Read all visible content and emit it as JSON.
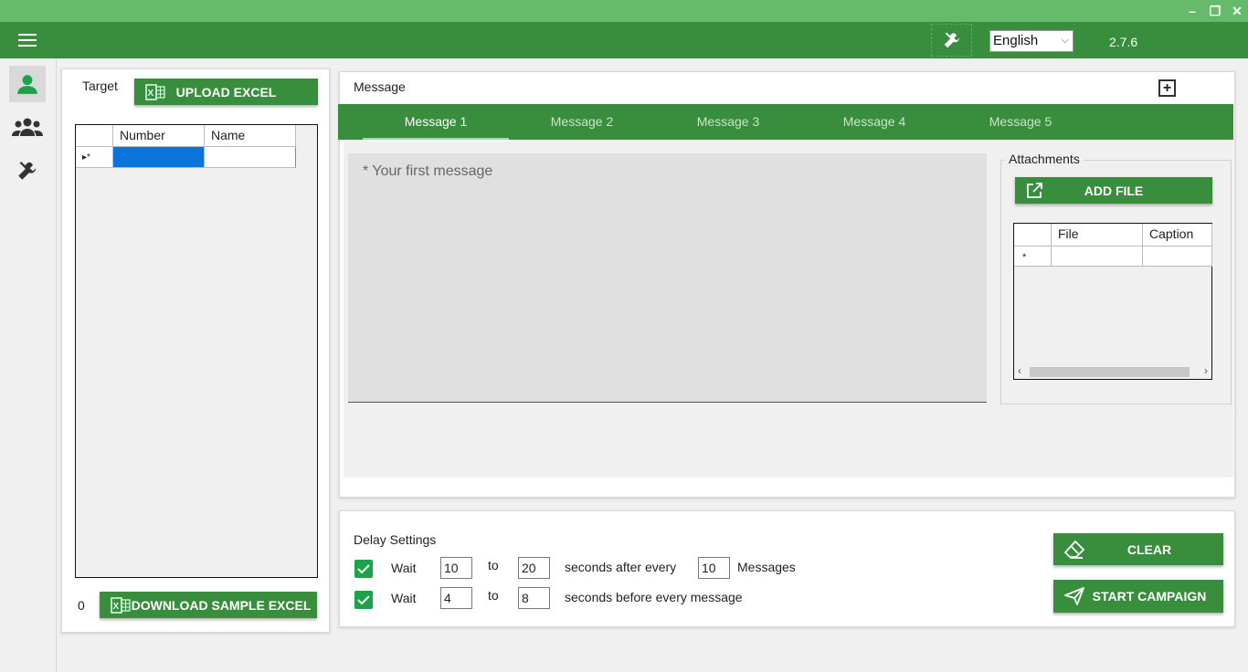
{
  "window": {
    "minimize": "–",
    "maximize": "❐",
    "close": "✕"
  },
  "toolbar": {
    "language": "English",
    "version": "2.7.6"
  },
  "target": {
    "label": "Target",
    "upload_label": "UPLOAD EXCEL",
    "columns": [
      "Number",
      "Name"
    ],
    "row_marker": "▸*",
    "count": "0",
    "download_label": "DOWNLOAD SAMPLE EXCEL"
  },
  "message": {
    "label": "Message",
    "tabs": [
      "Message 1",
      "Message 2",
      "Message 3",
      "Message 4",
      "Message 5"
    ],
    "active_tab": 0,
    "placeholder": "* Your first message"
  },
  "attachments": {
    "label": "Attachments",
    "add_label": "ADD FILE",
    "columns": [
      "File",
      "Caption"
    ],
    "row_marker": "*"
  },
  "delay": {
    "label": "Delay Settings",
    "row1": {
      "wait": "Wait",
      "from": "10",
      "to_label": "to",
      "to": "20",
      "text": "seconds after every",
      "count": "10",
      "unit": "Messages"
    },
    "row2": {
      "wait": "Wait",
      "from": "4",
      "to_label": "to",
      "to": "8",
      "text": "seconds before every message"
    }
  },
  "actions": {
    "clear_label": "CLEAR",
    "start_label": "START CAMPAIGN"
  },
  "colors": {
    "primary": "#388e3c",
    "titlebar": "#66bb6a",
    "accent": "#1aa34a",
    "selection": "#0a74da"
  }
}
